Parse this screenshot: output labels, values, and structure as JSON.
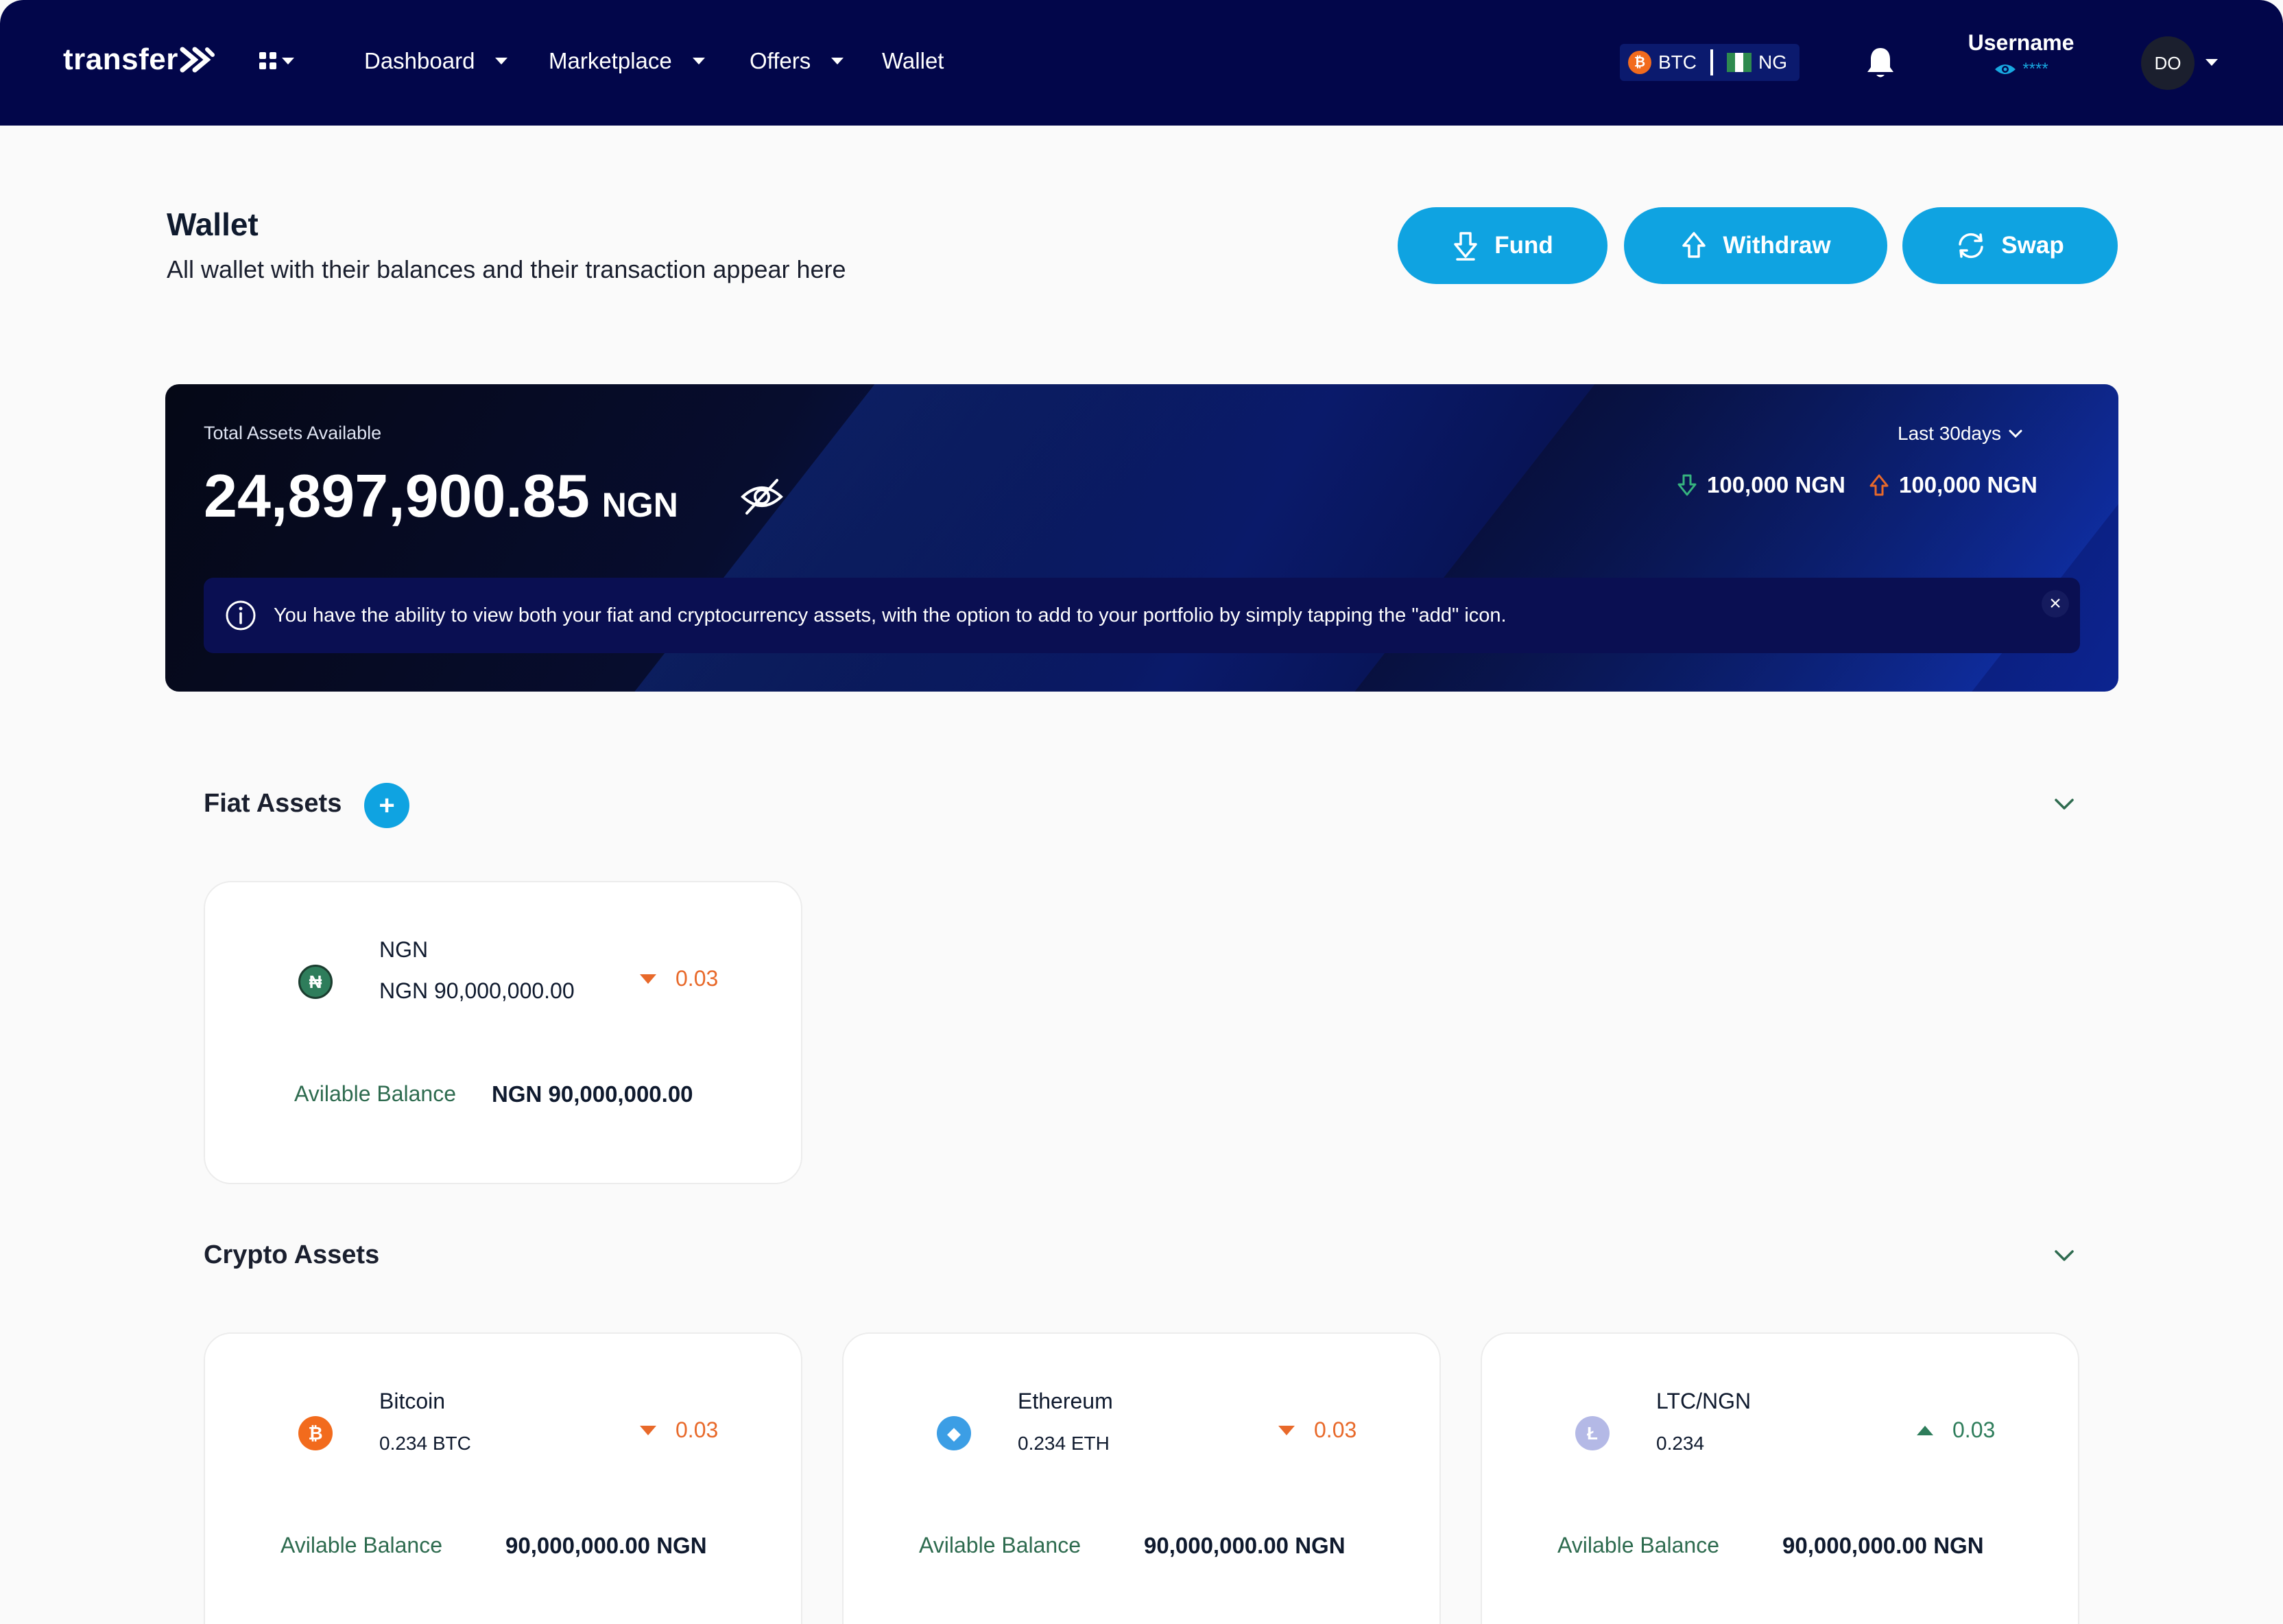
{
  "nav": {
    "logo": "transfer",
    "links": [
      {
        "label": "Dashboard",
        "has_menu": true
      },
      {
        "label": "Marketplace",
        "has_menu": true
      },
      {
        "label": "Offers",
        "has_menu": true
      },
      {
        "label": "Wallet",
        "has_menu": false
      }
    ],
    "currency_pill": {
      "crypto": "BTC",
      "country": "NG"
    },
    "username": "Username",
    "masked_balance": "****",
    "avatar_initials": "DO"
  },
  "page": {
    "title": "Wallet",
    "subtitle": "All wallet with their balances and their transaction appear here",
    "actions": {
      "fund": "Fund",
      "withdraw": "Withdraw",
      "swap": "Swap"
    }
  },
  "summary": {
    "label": "Total Assets Available",
    "amount": "24,897,900.85",
    "currency": "NGN",
    "period": "Last 30days",
    "inflow": "100,000 NGN",
    "outflow": "100,000 NGN",
    "info": "You have the ability to view both your fiat and cryptocurrency assets, with the option to add to your portfolio by simply tapping the \"add\" icon.",
    "close": "×"
  },
  "fiat": {
    "title": "Fiat Assets",
    "add": "+",
    "cards": [
      {
        "name": "NGN",
        "amount": "NGN 90,000,000.00",
        "change": "0.03",
        "direction": "down",
        "balance_label": "Avilable Balance",
        "balance": "NGN 90,000,000.00",
        "icon": "naira-icon",
        "icon_glyph": "₦",
        "color": "#2e7d5b"
      }
    ]
  },
  "crypto": {
    "title": "Crypto Assets",
    "cards": [
      {
        "name": "Bitcoin",
        "amount": "0.234 BTC",
        "change": "0.03",
        "direction": "down",
        "balance_label": "Avilable Balance",
        "balance": "90,000,000.00 NGN",
        "icon": "bitcoin-icon",
        "icon_glyph": "₿",
        "color": "#f26b1d"
      },
      {
        "name": "Ethereum",
        "amount": "0.234 ETH",
        "change": "0.03",
        "direction": "down",
        "balance_label": "Avilable Balance",
        "balance": "90,000,000.00 NGN",
        "icon": "ethereum-icon",
        "icon_glyph": "◆",
        "color": "#3c9ee5"
      },
      {
        "name": "LTC/NGN",
        "amount": "0.234",
        "change": "0.03",
        "direction": "up",
        "balance_label": "Avilable Balance",
        "balance": "90,000,000.00 NGN",
        "icon": "litecoin-icon",
        "icon_glyph": "Ł",
        "color": "#b4b9e6"
      }
    ]
  },
  "colors": {
    "primary": "#0fa3e1",
    "nav_bg": "#02064a",
    "down": "#e8692a",
    "up": "#2e7d5b"
  }
}
